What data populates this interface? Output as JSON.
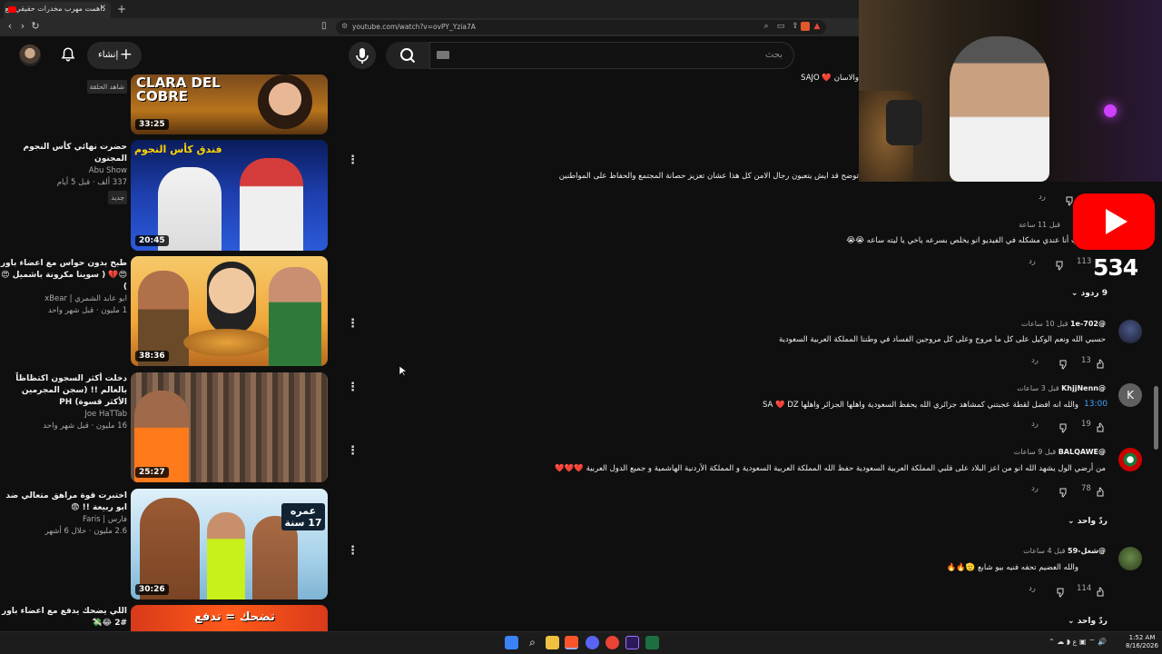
{
  "browser": {
    "tab_title": "داهمت مهرب مخدرات حقيقي مع",
    "url": "youtube.com/watch?v=ovPY_Yzia7A"
  },
  "header": {
    "create_label": "إنشاء",
    "search_placeholder": "بحث"
  },
  "related": [
    {
      "title": "",
      "channel": "",
      "meta": "",
      "badge": "شاهد الحلقة",
      "duration": "33:25",
      "thumb_text": "CLARA DEL COBRE"
    },
    {
      "title": "حضرت نهائي كأس النجوم المجنون",
      "channel": "Abu Show",
      "meta": "337 ألف · قبل 5 أيام",
      "badge": "جديد",
      "duration": "20:45",
      "thumb_text": "فندق كأس النجوم"
    },
    {
      "title": "طبخ بدون حواس مع اعضاء باور 😍💔 ( سوينا مكرونة باشميل 😍 )",
      "channel": "ابو عابد الشمري | xBear",
      "meta": "1 مليون · قبل شهر واحد",
      "badge": "",
      "duration": "38:36",
      "thumb_text": ""
    },
    {
      "title": "دخلت أكثر السجون اكتظاظاً بالعالم !! (سجن المجرمين الأكثر قسوة) PH",
      "channel": "Joe HaTTab",
      "meta": "16 مليون · قبل شهر واحد",
      "badge": "",
      "duration": "25:27",
      "thumb_text": ""
    },
    {
      "title": "اختبرت قوة مراهق متعالي ضد ابو ربيعة !! 😨",
      "channel": "فارس | Faris",
      "meta": "2.6 مليون · خلال 6 أشهر",
      "badge": "",
      "duration": "30:26",
      "thumb_text": "عمره 17 سنة"
    },
    {
      "title": "اللي يضحك يدفع مع اعضاء باور #2 😂💸",
      "channel": "",
      "meta": "",
      "badge": "",
      "duration": "",
      "thumb_text": "تضحك = تدفع"
    }
  ],
  "comments": {
    "top_text_1": "والاسان ❤️ SAJO",
    "top_text_2": "توضح قد ايش يتعبون رجال الامن كل هذا عشان تعزيز حصانة المجتمع والحفاظ على المواطنين",
    "reply_label": "رد",
    "c2_time": "قبل 11 ساعة",
    "c2_text": "ب أنا عندي مشكله في الفيديو انو يخلص بسرعه ياخي يا ليته ساعه 😭😭",
    "c2_likes": "113",
    "c2_replies": "9 ردود",
    "items": [
      {
        "author": "@1e-702",
        "time": "قبل 10 ساعات",
        "text": "حسبي الله ونعم الوكيل على كل ما مروج وعلى كل مروجين الفساد في وطننا المملكة العربية السعودية",
        "likes": "13",
        "replies": ""
      },
      {
        "author": "@KhjjNenn",
        "time": "قبل 3 ساعات",
        "timestamp_link": "13:00",
        "text": "والله انه افضل لقطة عجبتني كمشاهد جزائري الله يحفظ السعودية واهلها الجزائر واهلها SA ❤️ DZ",
        "likes": "19",
        "replies": "",
        "avatar_letter": "K"
      },
      {
        "author": "@BALQAWE",
        "time": "قبل 9 ساعات",
        "text": "من أرضي الول يشهد الله انو من اعز البلاد على قلبي المملكة العربية السعودية حفظ الله المملكة العربية السعودية و المملكة الأردنية الهاشمية و جميع الدول العربية ❤️❤️❤️",
        "likes": "78",
        "replies": "ردّ واحد"
      },
      {
        "author": "@شغل-59",
        "time": "قبل 4 ساعات",
        "text": "والله العضيم تحفه فنيه بيو شابع 🫡🔥🔥",
        "likes": "114",
        "replies": "ردّ واحد"
      }
    ]
  },
  "overlay": {
    "subscriber_count": "534"
  },
  "taskbar": {
    "time": "1:52 AM",
    "date": "8/16/2026",
    "lang": "ع"
  },
  "colors": {
    "bg": "#0f0f0f",
    "yt_red": "#ff0000",
    "link_blue": "#3ea6ff"
  }
}
